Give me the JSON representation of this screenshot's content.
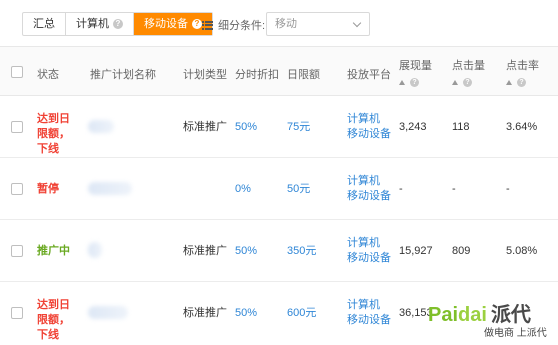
{
  "toolbar": {
    "tabs": [
      {
        "label": "汇总",
        "help": false,
        "active": false
      },
      {
        "label": "计算机",
        "help": true,
        "active": false
      },
      {
        "label": "移动设备",
        "help": true,
        "active": true
      }
    ],
    "filter_label": "细分条件:",
    "filter_value": "移动",
    "accent_color": "#ff8a00"
  },
  "table": {
    "headers": {
      "status": "状态",
      "plan_name": "推广计划名称",
      "plan_type": "计划类型",
      "discount": "分时折扣",
      "budget": "日限额",
      "platform": "投放平台",
      "impressions": "展现量",
      "clicks": "点击量",
      "ctr": "点击率"
    },
    "rows": [
      {
        "status": "达到日限额，下线",
        "status_color": "#f04134",
        "plan_type": "标准推广",
        "discount": "50%",
        "budget": "75元",
        "platform": "计算机 移动设备",
        "impressions": "3,243",
        "clicks": "118",
        "ctr": "3.64%"
      },
      {
        "status": "暂停",
        "status_color": "#f04134",
        "plan_type": "",
        "discount": "0%",
        "budget": "50元",
        "platform": "计算机 移动设备",
        "impressions": "-",
        "clicks": "-",
        "ctr": "-"
      },
      {
        "status": "推广中",
        "status_color": "#6aa922",
        "plan_type": "标准推广",
        "discount": "50%",
        "budget": "350元",
        "platform": "计算机 移动设备",
        "impressions": "15,927",
        "clicks": "809",
        "ctr": "5.08%"
      },
      {
        "status": "达到日限额，下线",
        "status_color": "#f04134",
        "plan_type": "标准推广",
        "discount": "50%",
        "budget": "600元",
        "platform": "计算机 移动设备",
        "impressions": "36,153",
        "clicks": "",
        "ctr": ""
      }
    ]
  },
  "watermark": {
    "logo_a": "Pai",
    "logo_b": "dai",
    "logo_c": "派代",
    "tagline": "做电商 上派代"
  }
}
